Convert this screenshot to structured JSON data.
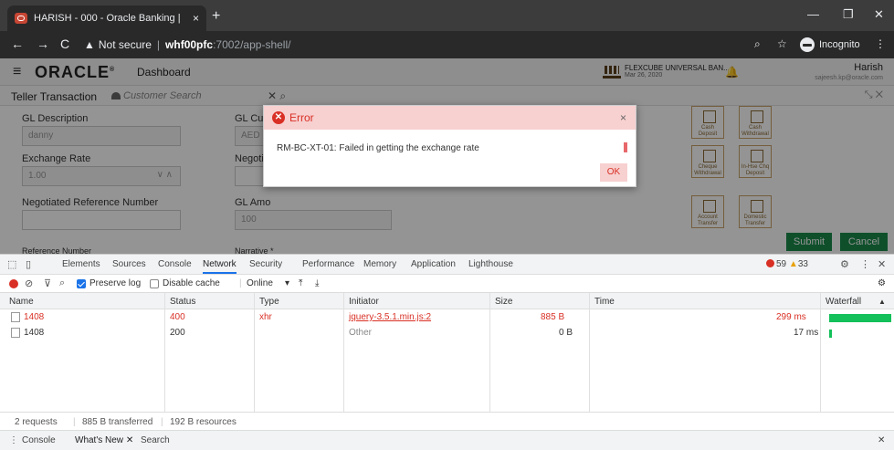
{
  "browser": {
    "tab_title": "HARISH - 000 - Oracle Banking |",
    "tab_close": "×",
    "new_tab": "+",
    "not_secure": "Not secure",
    "host": "whf00pfc",
    "path": ":7002/app-shell/",
    "incognito_label": "Incognito",
    "min_glyph": "—",
    "max_glyph": "❐",
    "close_glyph": "✕"
  },
  "app": {
    "logo": "ORACLE",
    "logo_mark": "®",
    "dashboard": "Dashboard",
    "product_name": "FLEXCUBE UNIVERSAL BAN...",
    "product_date": "Mar 26, 2020",
    "user_name": "Harish",
    "user_email": "sajeesh.kp@oracle.com",
    "screen_title": "Teller Transaction",
    "customer_search_placeholder": "Customer Search",
    "fields": {
      "gl_description_label": "GL Description",
      "gl_description_value": "danny",
      "gl_currency_label": "GL Curr",
      "gl_currency_value": "AED",
      "exchange_rate_label": "Exchange Rate",
      "exchange_rate_value": "1.00",
      "negotiated_label": "Negoti",
      "negotiated_ref_label": "Negotiated Reference Number",
      "gl_amount_label": "GL Amo",
      "gl_amount_value": "100",
      "reference_number_label": "Reference Number",
      "narrative_label": "Narrative *"
    },
    "tiles": [
      {
        "label": "Cash Deposit"
      },
      {
        "label": "Cash Withdrawal"
      },
      {
        "label": "Cheque Withdrawal"
      },
      {
        "label": "In-Hse Chq Deposit"
      },
      {
        "label": "Account Transfer"
      },
      {
        "label": "Domestic Transfer"
      }
    ],
    "submit": "Submit",
    "cancel": "Cancel"
  },
  "modal": {
    "title": "Error",
    "message": "RM-BC-XT-01: Failed in getting the exchange rate",
    "ok": "OK",
    "close": "×"
  },
  "devtools": {
    "tabs": [
      "Elements",
      "Sources",
      "Console",
      "Network",
      "Security",
      "Performance",
      "Memory",
      "Application",
      "Lighthouse"
    ],
    "active_tab": "Network",
    "error_count": "59",
    "warning_count": "33",
    "toolbar": {
      "preserve_log": "Preserve log",
      "disable_cache": "Disable cache",
      "throttle": "Online"
    },
    "columns": [
      "Name",
      "Status",
      "Type",
      "Initiator",
      "Size",
      "Time",
      "Waterfall"
    ],
    "rows": [
      {
        "name": "1408",
        "status": "400",
        "type": "xhr",
        "initiator": "jquery-3.5.1.min.js:2",
        "size": "885 B",
        "time": "299 ms"
      },
      {
        "name": "1408",
        "status": "200",
        "type": "",
        "initiator": "Other",
        "size": "0 B",
        "time": "17 ms"
      }
    ],
    "status_bar": {
      "requests": "2 requests",
      "transferred": "885 B transferred",
      "resources": "192 B resources"
    },
    "drawer": {
      "console": "Console",
      "whats_new": "What's New",
      "search": "Search"
    }
  },
  "colors": {
    "error": "#d93025",
    "accent": "#1a73e8",
    "submit_green": "#1a8a4a",
    "waterfall_green": "#13c05a"
  }
}
